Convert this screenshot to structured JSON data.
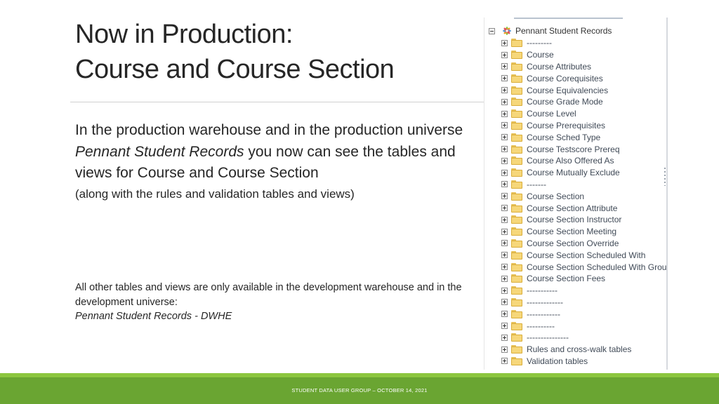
{
  "slide": {
    "title_line1": "Now in Production:",
    "title_line2": "Course and Course Section",
    "body": {
      "p1_pre": "In the production warehouse and in the production universe ",
      "p1_italic": "Pennant Student Records",
      "p1_post": " you now can see the tables and views for Course and Course Section",
      "p1_note": "(along with the rules and validation tables and views)",
      "p2_main": "All other tables and views are only available in the development warehouse and in the development universe:",
      "p2_italic": "Pennant Student Records - DWHE"
    },
    "footer": "STUDENT DATA USER GROUP – OCTOBER 14, 2021"
  },
  "tree": {
    "root_label": "Pennant Student Records",
    "items": [
      "---------",
      "Course",
      "Course Attributes",
      "Course Corequisites",
      "Course Equivalencies",
      "Course Grade Mode",
      "Course Level",
      "Course Prerequisites",
      "Course Sched Type",
      "Course Testscore Prereq",
      "Course Also Offered As",
      "Course Mutually Exclude",
      "-------",
      "Course Section",
      "Course Section Attribute",
      "Course Section Instructor",
      "Course Section Meeting",
      "Course Section Override",
      "Course Section Scheduled With",
      "Course Section Scheduled With Group",
      "Course Section Fees",
      "-----------",
      "-------------",
      "------------",
      "----------",
      "---------------",
      "Rules and cross-walk tables",
      "Validation tables"
    ]
  },
  "colors": {
    "footer_band": "#6aa532",
    "footer_band_light": "#8cc63f",
    "folder": "#f6d77a"
  },
  "icons": {
    "root": "universe-star-icon",
    "expand": "plus-box-icon",
    "collapse": "minus-box-icon",
    "item": "folder-icon"
  }
}
